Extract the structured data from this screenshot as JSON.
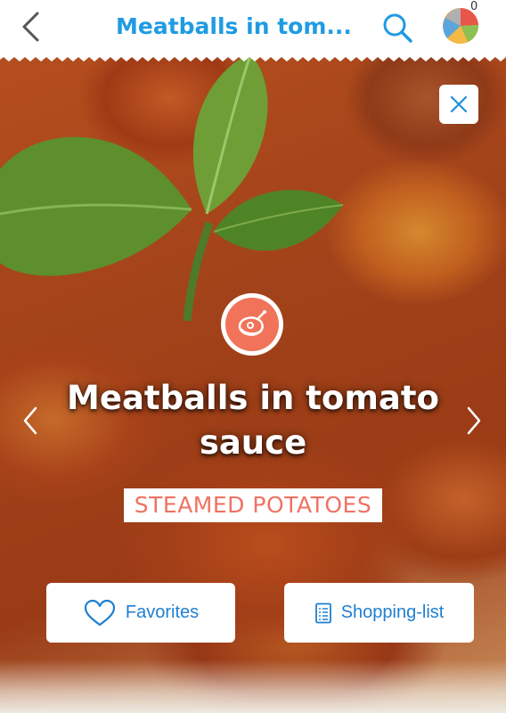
{
  "header": {
    "title": "Meatballs in tom...",
    "pie_count": "0"
  },
  "recipe": {
    "title": "Meatballs in tomato sauce",
    "side_dish": "STEAMED POTATOES"
  },
  "actions": {
    "favorites_label": "Favorites",
    "shopping_label": "Shopping-list"
  },
  "colors": {
    "accent": "#1f9be2",
    "badge": "#f0735a",
    "side_dish_text": "#ee7363"
  },
  "icons": {
    "back": "chevron-left-icon",
    "search": "search-icon",
    "pie": "pie-chart-icon",
    "close": "close-icon",
    "category": "meat-icon",
    "prev": "chevron-left-icon",
    "next": "chevron-right-icon",
    "favorites": "heart-icon",
    "shopping": "list-icon"
  }
}
